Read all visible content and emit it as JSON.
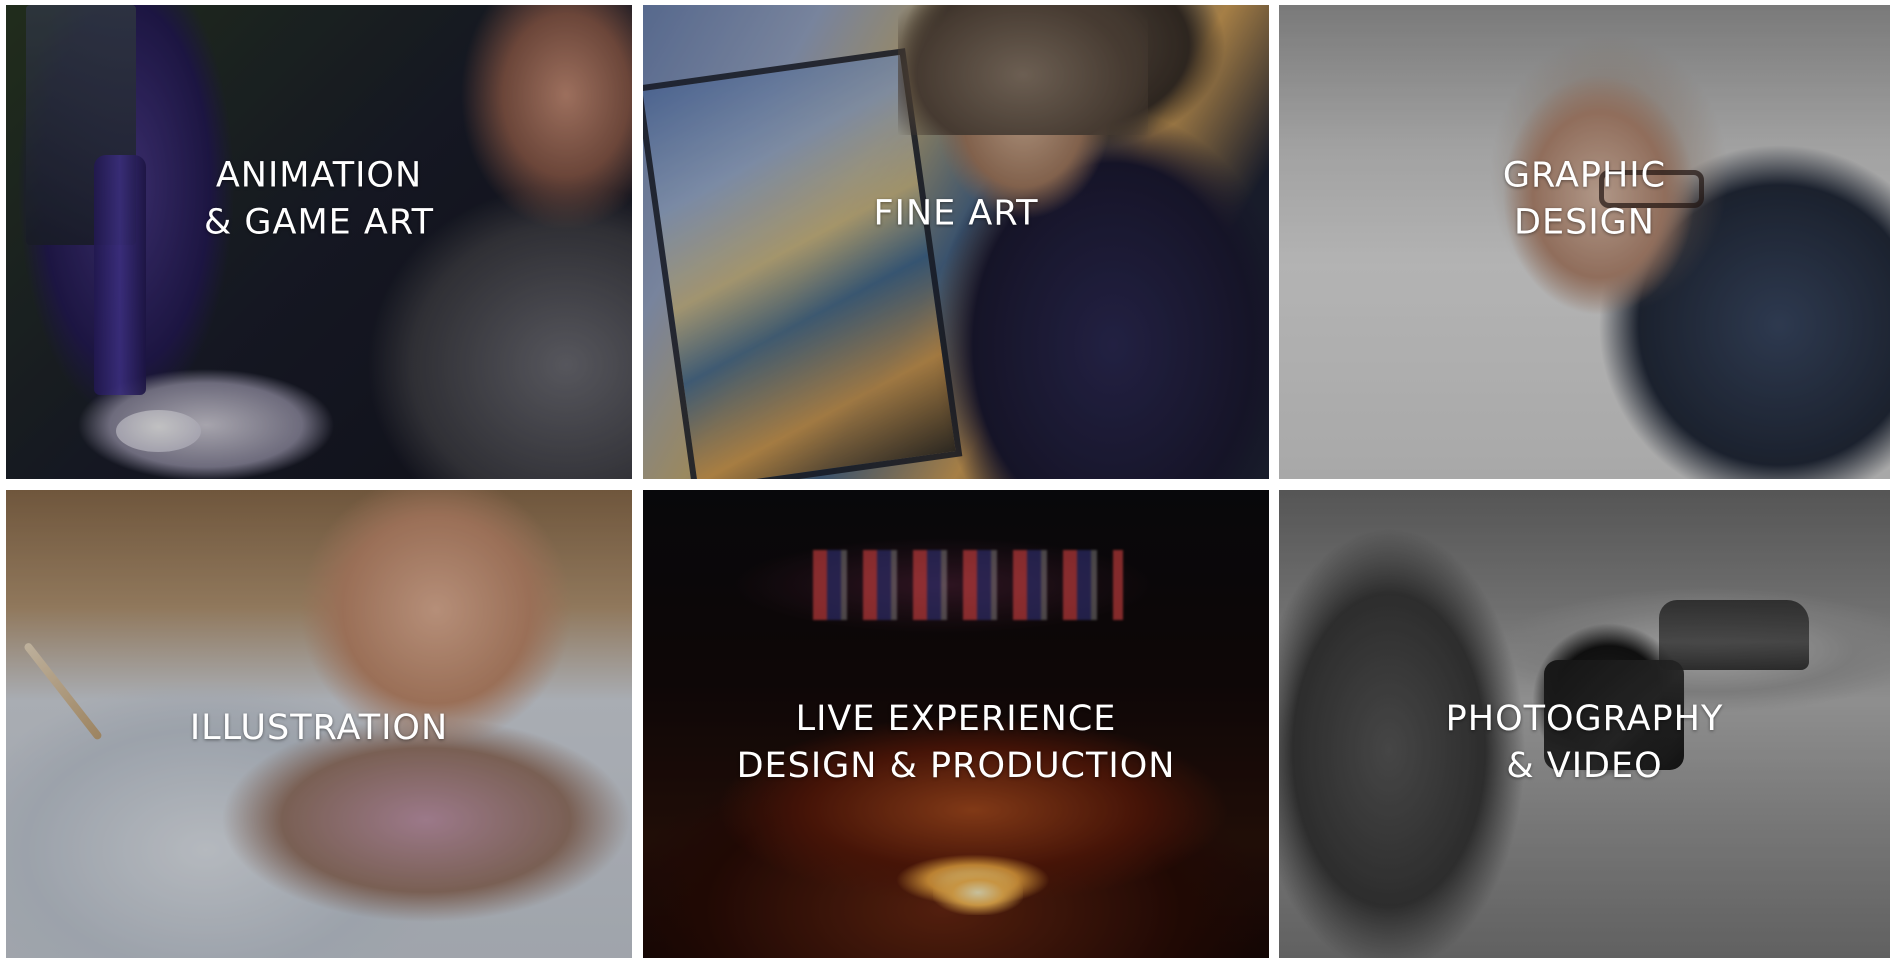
{
  "tiles": [
    {
      "id": "animation-game-art",
      "label": "ANIMATION\n& GAME ART"
    },
    {
      "id": "fine-art",
      "label": "FINE ART"
    },
    {
      "id": "graphic-design",
      "label": "GRAPHIC\nDESIGN"
    },
    {
      "id": "illustration",
      "label": "ILLUSTRATION"
    },
    {
      "id": "live-experience",
      "label": "LIVE EXPERIENCE\nDESIGN & PRODUCTION"
    },
    {
      "id": "photography-video",
      "label": "PHOTOGRAPHY\n& VIDEO"
    }
  ],
  "colors": {
    "label_text": "#ffffff",
    "background": "#ffffff"
  }
}
